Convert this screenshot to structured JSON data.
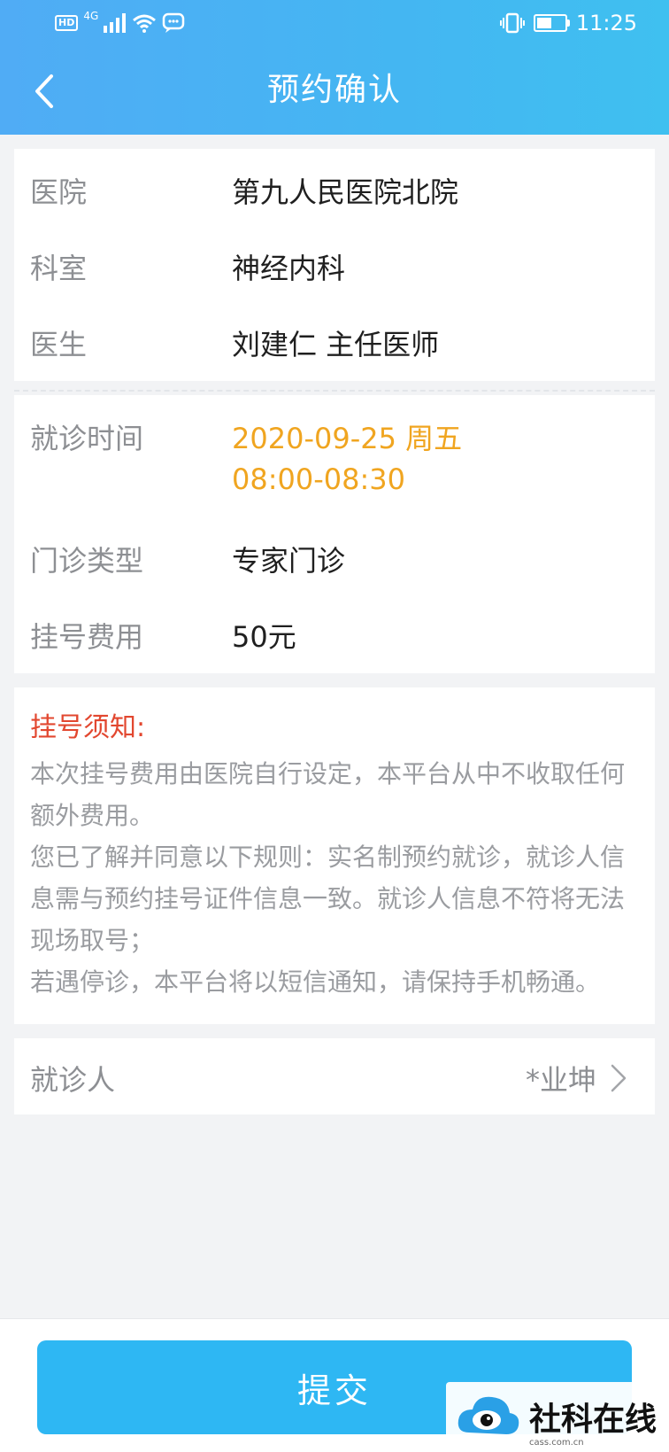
{
  "status_bar": {
    "network": "4G",
    "time": "11:25",
    "hd_label": "HD"
  },
  "header": {
    "title": "预约确认",
    "back_icon": "chevron-left-icon"
  },
  "appointment": {
    "hospital_label": "医院",
    "hospital_value": "第九人民医院北院",
    "department_label": "科室",
    "department_value": "神经内科",
    "doctor_label": "医生",
    "doctor_value": "刘建仁  主任医师",
    "time_label": "就诊时间",
    "date_value": "2020-09-25  周五",
    "slot_value": "08:00-08:30",
    "type_label": "门诊类型",
    "type_value": "专家门诊",
    "fee_label": "挂号费用",
    "fee_value": "50元"
  },
  "notice": {
    "title": "挂号须知:",
    "paragraphs": [
      "本次挂号费用由医院自行设定，本平台从中不收取任何额外费用。",
      "您已了解并同意以下规则：实名制预约就诊，就诊人信息需与预约挂号证件信息一致。就诊人信息不符将无法现场取号；",
      "若遇停诊，本平台将以短信通知，请保持手机畅通。"
    ]
  },
  "patient": {
    "label": "就诊人",
    "value": "*业坤"
  },
  "footer": {
    "submit_label": "提交"
  },
  "watermark": {
    "text": "社科在线",
    "sub": "cass.com.cn"
  },
  "colors": {
    "header_start": "#50acf5",
    "header_end": "#3fc0f0",
    "accent_orange": "#f0a520",
    "notice_red": "#e2472f",
    "button_blue": "#2eb7f3"
  }
}
